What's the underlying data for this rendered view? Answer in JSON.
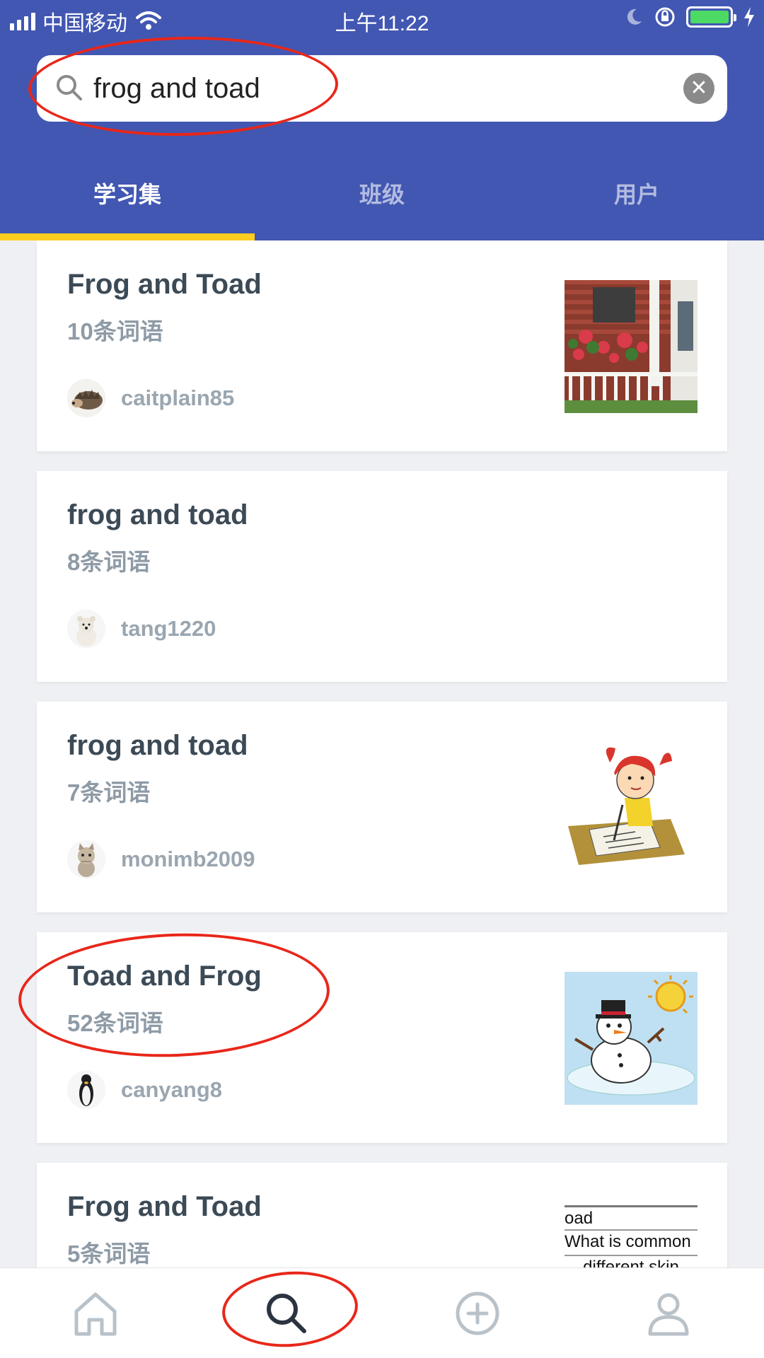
{
  "status_bar": {
    "carrier": "中国移动",
    "time": "上午11:22"
  },
  "search": {
    "query": "frog and toad"
  },
  "tabs": [
    {
      "label": "学习集",
      "active": true
    },
    {
      "label": "班级",
      "active": false
    },
    {
      "label": "用户",
      "active": false
    }
  ],
  "results": [
    {
      "title": "Frog and Toad",
      "count": "10条词语",
      "user": "caitplain85",
      "avatar": "hedgehog",
      "thumb": "porch-photo"
    },
    {
      "title": "frog and toad",
      "count": "8条词语",
      "user": "tang1220",
      "avatar": "polar-bear",
      "thumb": ""
    },
    {
      "title": "frog and toad",
      "count": "7条词语",
      "user": "monimb2009",
      "avatar": "kitten",
      "thumb": "girl-writing-cartoon"
    },
    {
      "title": "Toad and Frog",
      "count": "52条词语",
      "user": "canyang8",
      "avatar": "penguin",
      "thumb": "melting-snowman-cartoon"
    },
    {
      "title": "Frog and Toad",
      "count": "5条词语",
      "user": "",
      "avatar": "",
      "thumb": "worksheet-text",
      "thumb_lines": [
        "oad",
        "What is common",
        "different skin"
      ]
    }
  ],
  "colors": {
    "header": "#4257b2",
    "tab_indicator": "#ffcd1f",
    "annotation": "#e8271a"
  }
}
